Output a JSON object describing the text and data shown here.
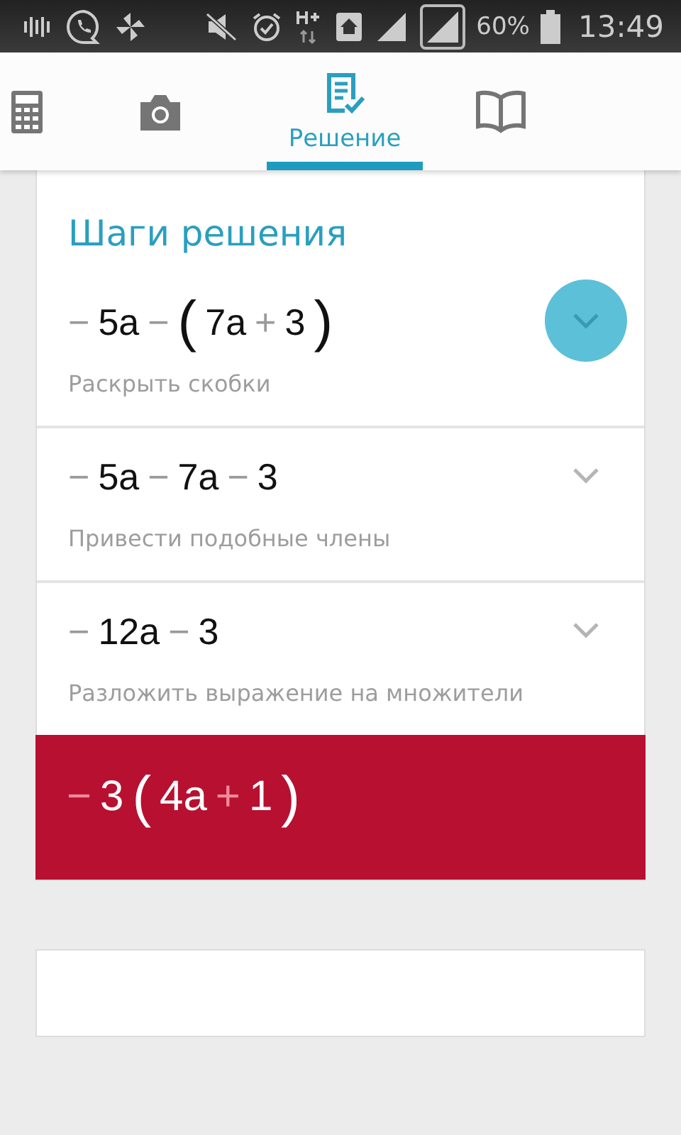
{
  "status_bar": {
    "battery": "60%",
    "time": "13:49"
  },
  "tabs": [
    {
      "kind": "calculator",
      "selected": false
    },
    {
      "kind": "camera",
      "selected": false
    },
    {
      "kind": "solution",
      "label": "Решение",
      "selected": true
    },
    {
      "kind": "book",
      "selected": false
    }
  ],
  "card": {
    "title": "Шаги решения",
    "steps": [
      {
        "expression": [
          {
            "kind": "op",
            "t": "−"
          },
          {
            "kind": "term",
            "t": "5a"
          },
          {
            "kind": "op",
            "t": "−"
          },
          {
            "kind": "paren",
            "t": "("
          },
          {
            "kind": "term",
            "t": "7a"
          },
          {
            "kind": "op",
            "t": "+"
          },
          {
            "kind": "term",
            "t": "3"
          },
          {
            "kind": "paren",
            "t": ")"
          }
        ],
        "description": "Раскрыть скобки",
        "highlighted": true
      },
      {
        "expression": [
          {
            "kind": "op",
            "t": "−"
          },
          {
            "kind": "term",
            "t": "5a"
          },
          {
            "kind": "op",
            "t": "−"
          },
          {
            "kind": "term",
            "t": "7a"
          },
          {
            "kind": "op",
            "t": "−"
          },
          {
            "kind": "term",
            "t": "3"
          }
        ],
        "description": "Привести подобные члены",
        "highlighted": false
      },
      {
        "expression": [
          {
            "kind": "op",
            "t": "−"
          },
          {
            "kind": "term",
            "t": "12a"
          },
          {
            "kind": "op",
            "t": "−"
          },
          {
            "kind": "term",
            "t": "3"
          }
        ],
        "description": "Разложить выражение на множители",
        "highlighted": false
      }
    ],
    "result": [
      {
        "kind": "op",
        "t": "−"
      },
      {
        "kind": "term",
        "t": "3"
      },
      {
        "kind": "paren",
        "t": "("
      },
      {
        "kind": "term",
        "t": "4a"
      },
      {
        "kind": "op",
        "t": "+"
      },
      {
        "kind": "term",
        "t": "1"
      },
      {
        "kind": "paren",
        "t": ")"
      }
    ]
  }
}
